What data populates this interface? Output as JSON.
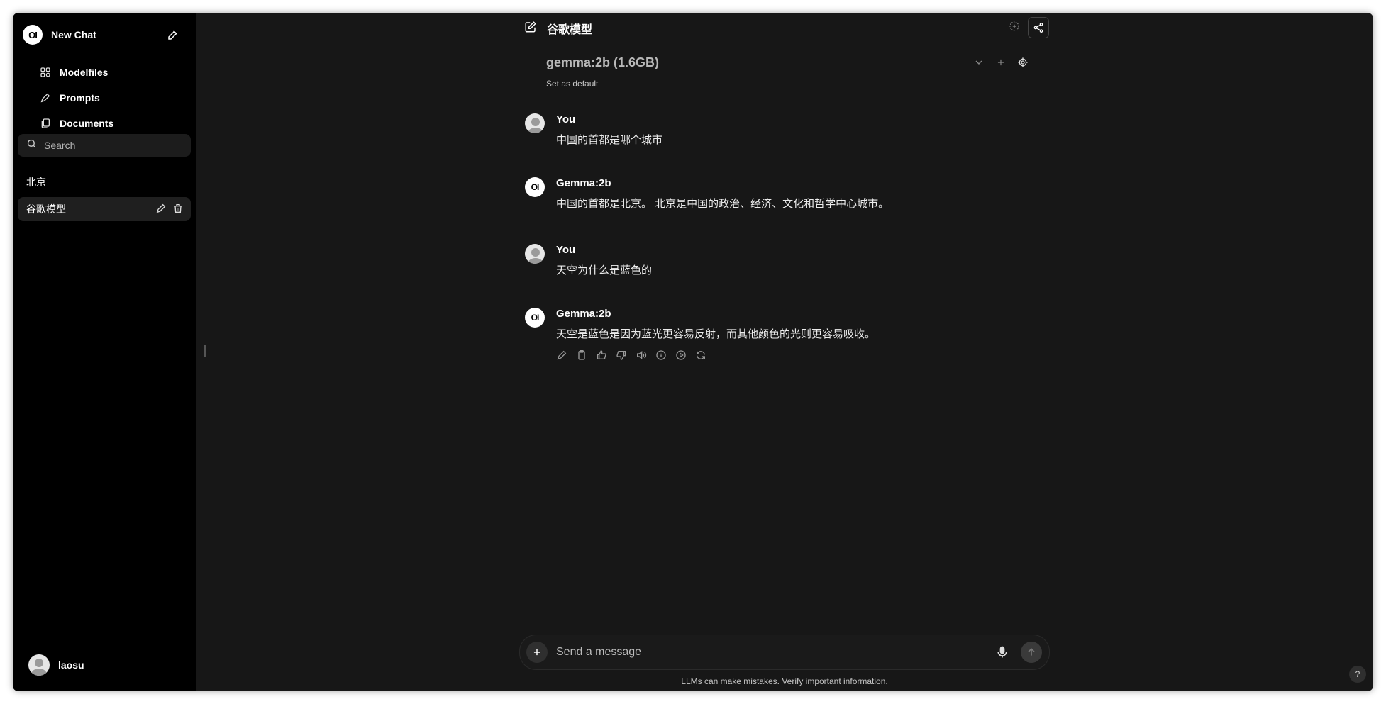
{
  "sidebar": {
    "logo_text": "OI",
    "new_chat_label": "New Chat",
    "nav": [
      {
        "label": "Modelfiles",
        "icon": "modelfiles-icon"
      },
      {
        "label": "Prompts",
        "icon": "pencil-icon"
      },
      {
        "label": "Documents",
        "icon": "documents-icon"
      }
    ],
    "search_placeholder": "Search",
    "chats": [
      {
        "title": "北京"
      },
      {
        "title": "谷歌模型",
        "active": true
      }
    ],
    "user": {
      "name": "laosu"
    }
  },
  "header": {
    "title": "谷歌模型"
  },
  "model": {
    "selected": "gemma:2b (1.6GB)",
    "set_default": "Set as default"
  },
  "messages": [
    {
      "role": "user",
      "author": "You",
      "text": "中国的首都是哪个城市"
    },
    {
      "role": "assistant",
      "author": "Gemma:2b",
      "text": "中国的首都是北京。 北京是中国的政治、经济、文化和哲学中心城市。"
    },
    {
      "role": "user",
      "author": "You",
      "text": "天空为什么是蓝色的"
    },
    {
      "role": "assistant",
      "author": "Gemma:2b",
      "text": "天空是蓝色是因为蓝光更容易反射，而其他颜色的光则更容易吸收。"
    }
  ],
  "composer": {
    "placeholder": "Send a message"
  },
  "footer": {
    "disclaimer": "LLMs can make mistakes. Verify important information.",
    "help": "?"
  },
  "colors": {
    "sidebar_bg": "#000000",
    "main_bg": "#171717",
    "active_item_bg": "#1f1f1f"
  }
}
